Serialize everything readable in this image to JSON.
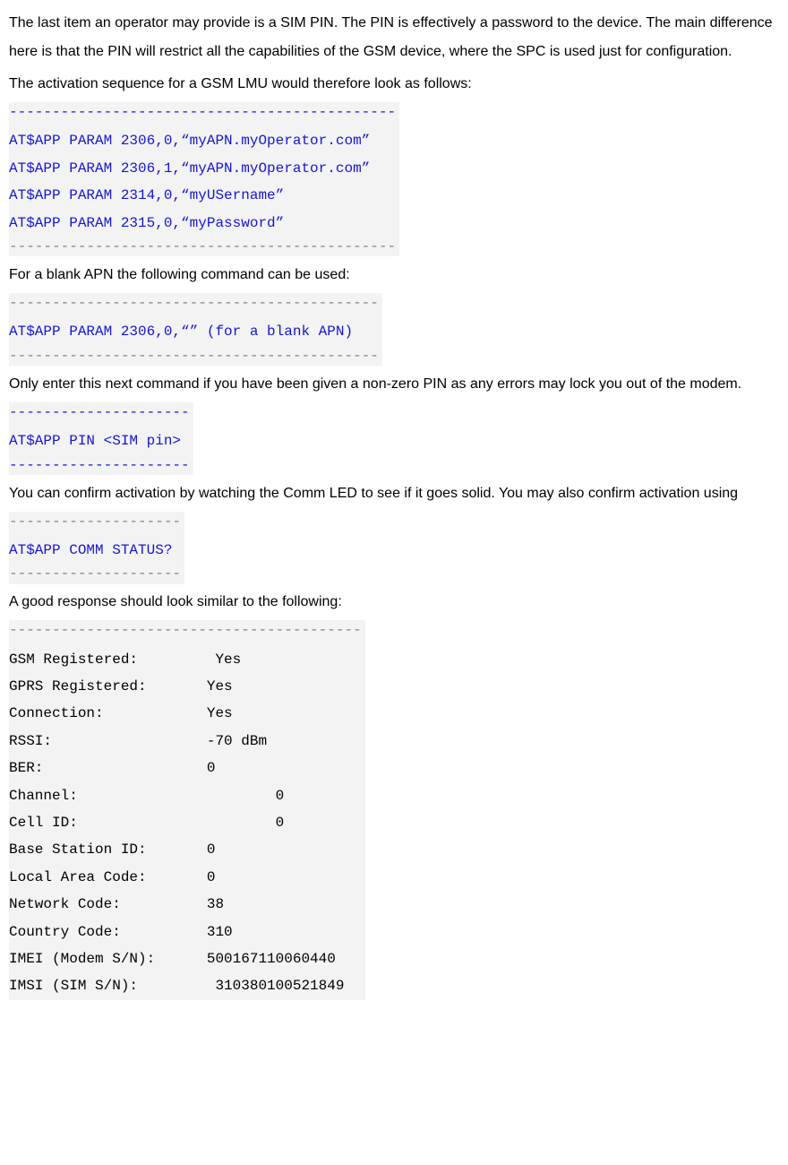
{
  "paragraphs": {
    "p1": "The last item an operator may provide is a SIM PIN. The PIN is effectively a password to the device. The main difference here is that the PIN will restrict all the capabilities of the GSM device, where the SPC is used just for configuration.",
    "p2": "The activation sequence for a GSM LMU would therefore look as follows:",
    "p3": "For a blank APN the following command can be used:",
    "p4": "Only enter this next command if you have been given a non-zero PIN as any errors may lock you out of the modem.",
    "p5": "You can confirm activation by watching the Comm LED to see if it goes solid. You may also confirm activation using",
    "p6": "A good response should look similar to the following:"
  },
  "code_blocks": {
    "block1": {
      "dash_top": "---------------------------------------------",
      "lines": [
        "AT$APP PARAM 2306,0,“myAPN.myOperator.com”",
        "AT$APP PARAM 2306,1,“myAPN.myOperator.com”",
        "AT$APP PARAM 2314,0,“myUSername”",
        "AT$APP PARAM 2315,0,“myPassword”"
      ],
      "dash_bottom": "---------------------------------------------"
    },
    "block2": {
      "dash_top": "-------------------------------------------",
      "lines": [
        "AT$APP PARAM 2306,0,“” (for a blank APN)"
      ],
      "dash_bottom": "-------------------------------------------"
    },
    "block3": {
      "dash_top": "---------------------",
      "lines": [
        "AT$APP PIN <SIM pin>"
      ],
      "dash_bottom": "---------------------"
    },
    "block4": {
      "dash_top": "--------------------",
      "lines": [
        "AT$APP COMM STATUS?"
      ],
      "dash_bottom": "--------------------"
    },
    "block5": {
      "dash_top": "-----------------------------------------",
      "lines": [
        "GSM Registered:         Yes",
        "GPRS Registered:       Yes",
        "Connection:            Yes",
        "RSSI:                  -70 dBm",
        "BER:                   0",
        "Channel:                       0",
        "Cell ID:                       0",
        "Base Station ID:       0",
        "Local Area Code:       0",
        "Network Code:          38",
        "Country Code:          310",
        "IMEI (Modem S/N):      500167110060440",
        "IMSI (SIM S/N):         310380100521849"
      ]
    }
  }
}
